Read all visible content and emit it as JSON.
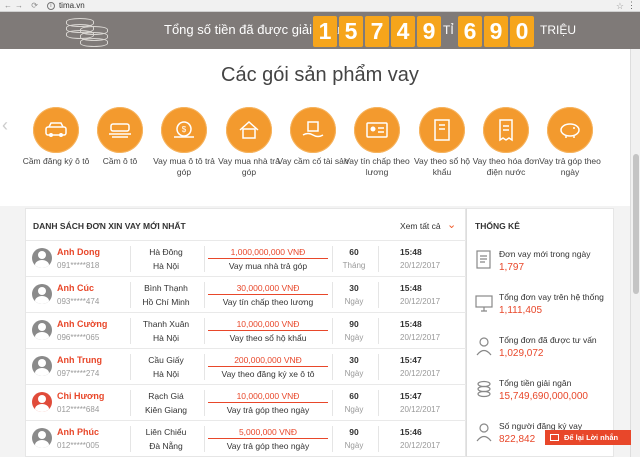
{
  "browser": {
    "url": "tima.vn"
  },
  "banner": {
    "title": "Tổng số tiền đã được giải ngân :",
    "billions_digits": [
      "1",
      "5",
      "7",
      "4",
      "9"
    ],
    "ti_label": "TỈ",
    "millions_digits": [
      "6",
      "9",
      "0"
    ],
    "trieu_label": "TRIỆU"
  },
  "products": {
    "title": "Các gói sản phẩm vay",
    "items": [
      {
        "label": "Cầm đăng ký ô tô",
        "icon": "car-registration-icon"
      },
      {
        "label": "Cầm ô tô",
        "icon": "car-pawn-icon"
      },
      {
        "label": "Vay mua ô tô trả góp",
        "icon": "car-installment-icon"
      },
      {
        "label": "Vay mua nhà trả góp",
        "icon": "house-icon"
      },
      {
        "label": "Vay cầm cố tài sản",
        "icon": "box-hand-icon"
      },
      {
        "label": "Vay tín chấp theo lương",
        "icon": "id-card-icon"
      },
      {
        "label": "Vay theo sổ hộ khẩu",
        "icon": "book-icon"
      },
      {
        "label": "Vay theo hóa đơn điện nước",
        "icon": "invoice-icon"
      },
      {
        "label": "Vay trả góp theo ngày",
        "icon": "piggy-bank-icon"
      }
    ]
  },
  "loans": {
    "header": "DANH SÁCH ĐƠN XIN VAY MỚI NHẤT",
    "see_all": "Xem tất cả",
    "rows": [
      {
        "name": "Anh Dong",
        "phone": "091*****818",
        "district": "Hà Đông",
        "city": "Hà Nội",
        "amount": "1,000,000,000 VNĐ",
        "type": "Vay mua nhà trả góp",
        "term": "60",
        "unit": "Tháng",
        "time": "15:48",
        "date": "20/12/2017",
        "avatar": "grey"
      },
      {
        "name": "Anh Cúc",
        "phone": "093*****474",
        "district": "Bình Thạnh",
        "city": "Hồ Chí Minh",
        "amount": "30,000,000 VNĐ",
        "type": "Vay tín chấp theo lương",
        "term": "30",
        "unit": "Ngày",
        "time": "15:48",
        "date": "20/12/2017",
        "avatar": "grey"
      },
      {
        "name": "Anh Cường",
        "phone": "096*****065",
        "district": "Thanh Xuân",
        "city": "Hà Nội",
        "amount": "10,000,000 VNĐ",
        "type": "Vay theo sổ hộ khẩu",
        "term": "90",
        "unit": "Ngày",
        "time": "15:48",
        "date": "20/12/2017",
        "avatar": "grey"
      },
      {
        "name": "Anh Trung",
        "phone": "097*****274",
        "district": "Cầu Giấy",
        "city": "Hà Nội",
        "amount": "200,000,000 VNĐ",
        "type": "Vay theo đăng ký xe ô tô",
        "term": "30",
        "unit": "Ngày",
        "time": "15:47",
        "date": "20/12/2017",
        "avatar": "grey"
      },
      {
        "name": "Chi Hương",
        "phone": "012*****684",
        "district": "Rạch Giá",
        "city": "Kiên Giang",
        "amount": "10,000,000 VNĐ",
        "type": "Vay trả góp theo ngày",
        "term": "60",
        "unit": "Ngày",
        "time": "15:47",
        "date": "20/12/2017",
        "avatar": "red"
      },
      {
        "name": "Anh Phúc",
        "phone": "012*****005",
        "district": "Liên Chiểu",
        "city": "Đà Nẵng",
        "amount": "5,000,000 VNĐ",
        "type": "Vay trả góp theo ngày",
        "term": "90",
        "unit": "Ngày",
        "time": "15:46",
        "date": "20/12/2017",
        "avatar": "grey"
      }
    ]
  },
  "stats": {
    "header": "THỐNG KÊ",
    "items": [
      {
        "label": "Đơn vay mới trong ngày",
        "value": "1,797",
        "icon": "document-icon"
      },
      {
        "label": "Tổng đơn vay trên hệ thống",
        "value": "1,111,405",
        "icon": "monitor-icon"
      },
      {
        "label": "Tổng đơn đã được tư vấn",
        "value": "1,029,072",
        "icon": "consultant-icon"
      },
      {
        "label": "Tổng tiền giải ngân",
        "value": "15,749,690,000,000",
        "icon": "coins-icon"
      },
      {
        "label": "Số người đăng ký vay",
        "value": "822,842",
        "icon": "person-icon"
      }
    ]
  },
  "chat": {
    "label": "Để lại Lời nhắn"
  }
}
